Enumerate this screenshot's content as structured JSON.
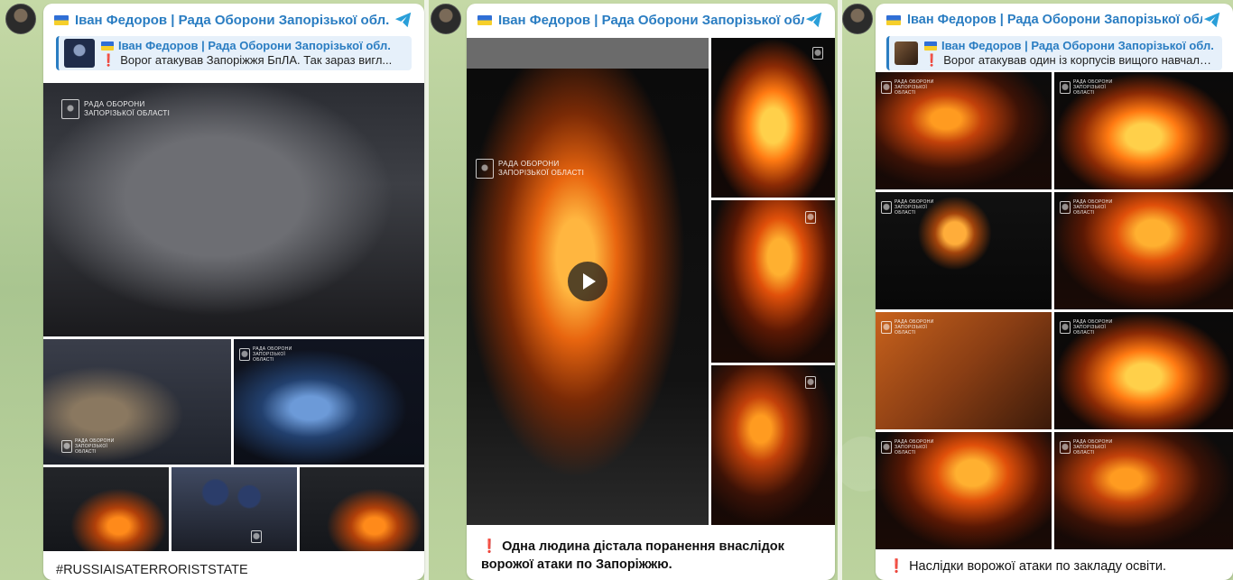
{
  "background": {
    "chat_color": "#b9cf9a",
    "accent": "#2a7dc2"
  },
  "posts": [
    {
      "channel": "Іван Федоров | Рада Оборони Запорізької обл.",
      "reply": {
        "channel": "Іван Федоров | Рада Оборони Запорізької обл.",
        "text": "Ворог атакував Запоріжжя БпЛА. Так зараз вигл..."
      },
      "photo_logo": "Рада Оборони Запорізької області",
      "caption": "#RUSSIAISATERRORISTSTATE"
    },
    {
      "channel": "Іван Федоров | Рада Оборони Запорізької обл.",
      "photo_logo": "Рада Оборони Запорізької області",
      "caption": "Одна людина дістала поранення внаслідок ворожої атаки по Запоріжжю."
    },
    {
      "channel": "Іван Федоров | Рада Оборони Запорізької обл.",
      "reply": {
        "channel": "Іван Федоров | Рада Оборони Запорізької обл.",
        "text": "Ворог атакував один із корпусів вищого навчальн..."
      },
      "photo_logo": "Рада Оборони Запорізької області",
      "caption": "Наслідки ворожої атаки по закладу освіти."
    }
  ],
  "icons": {
    "share": "telegram-share-icon",
    "play": "play-icon"
  }
}
